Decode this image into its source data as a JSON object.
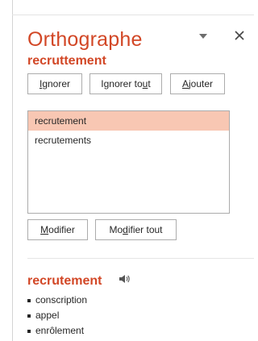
{
  "pane": {
    "title": "Orthographe",
    "misspelled_word": "recruttement"
  },
  "actions": {
    "ignore_prefix": "",
    "ignore_key": "I",
    "ignore_rest": "gnorer",
    "ignore_all_prefix": "Ignorer to",
    "ignore_all_key": "u",
    "ignore_all_rest": "t",
    "add_prefix": "",
    "add_key": "A",
    "add_rest": "jouter"
  },
  "suggestions": [
    "recrutement",
    "recrutements"
  ],
  "change": {
    "change_prefix": "",
    "change_key": "M",
    "change_rest": "odifier",
    "change_all_prefix": "Mo",
    "change_all_key": "d",
    "change_all_rest": "ifier tout"
  },
  "synonyms": {
    "word": "recrutement",
    "items": [
      "conscription",
      "appel",
      "enrôlement"
    ]
  },
  "colors": {
    "accent": "#d24726",
    "selection": "#f8c7b3"
  },
  "icons": {
    "dropdown": "chevron-down-icon",
    "close": "close-icon",
    "speaker": "speaker-icon"
  }
}
